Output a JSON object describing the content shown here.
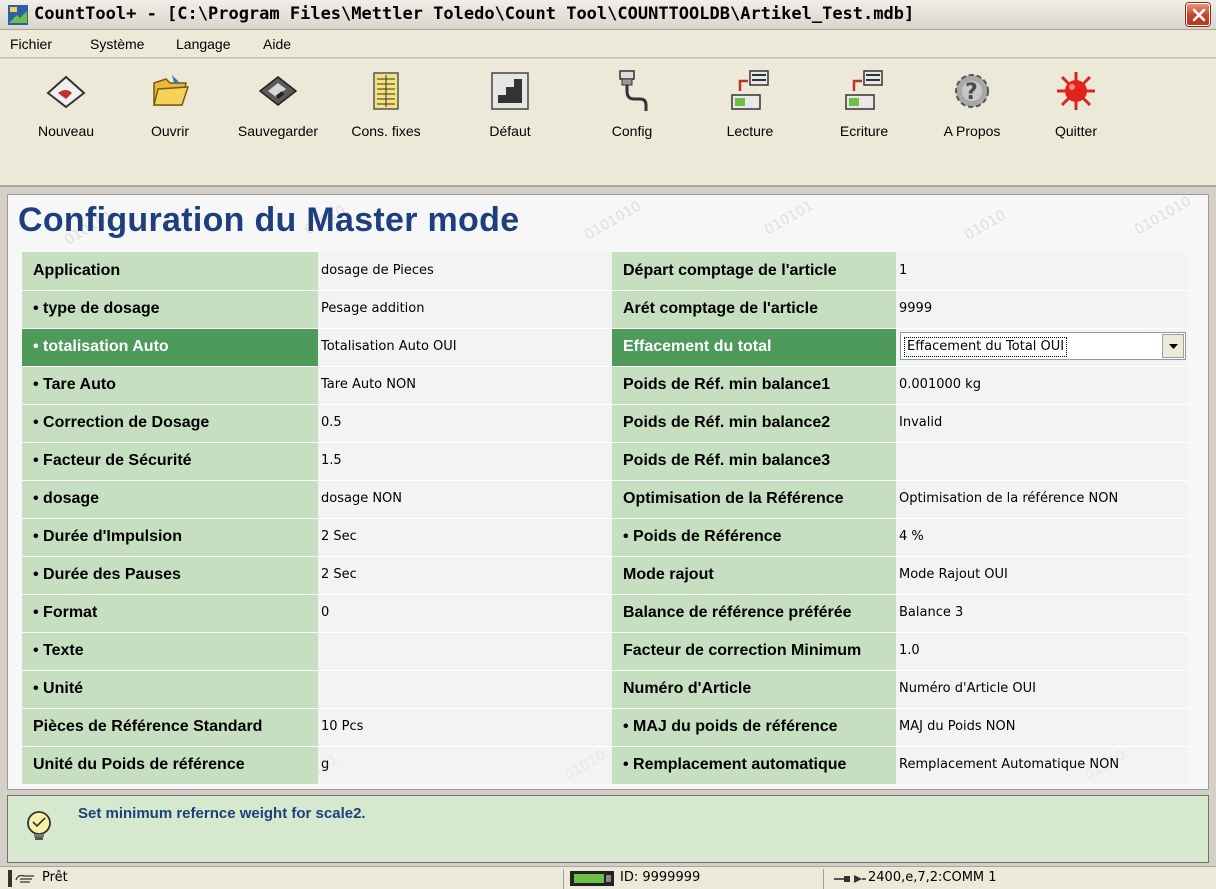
{
  "window": {
    "title": "CountTool+ - [C:\\Program Files\\Mettler Toledo\\Count Tool\\COUNTTOOLDB\\Artikel_Test.mdb]",
    "close_icon": "close-icon"
  },
  "menu": [
    {
      "label": "Fichier"
    },
    {
      "label": "Système"
    },
    {
      "label": "Langage"
    },
    {
      "label": "Aide"
    }
  ],
  "toolbar": [
    {
      "label": "Nouveau",
      "icon": "new-icon"
    },
    {
      "label": "Ouvrir",
      "icon": "open-icon"
    },
    {
      "label": "Sauvegarder",
      "icon": "save-icon"
    },
    {
      "label": "Cons. fixes",
      "icon": "constants-icon"
    },
    {
      "label": "Défaut",
      "icon": "default-icon"
    },
    {
      "label": "Config",
      "icon": "config-icon"
    },
    {
      "label": "Lecture",
      "icon": "read-icon"
    },
    {
      "label": "Ecriture",
      "icon": "write-icon"
    },
    {
      "label": "A Propos",
      "icon": "about-icon"
    },
    {
      "label": "Quitter",
      "icon": "quit-icon"
    }
  ],
  "main": {
    "title": "Configuration du Master mode",
    "rows": [
      {
        "l1": "Application",
        "v1": "dosage de Pieces",
        "l2": "Départ comptage de l'article",
        "v2": "1"
      },
      {
        "l1": "• type de dosage",
        "v1": "Pesage addition",
        "l2": "Arét comptage de l'article",
        "v2": "9999"
      },
      {
        "l1": "• totalisation Auto",
        "v1": "Totalisation Auto OUI",
        "l2": "Effacement du total",
        "v2": "Effacement du Total OUI"
      },
      {
        "l1": "• Tare Auto",
        "v1": "Tare Auto NON",
        "l2": "Poids de Réf. min balance1",
        "v2": "0.001000 kg"
      },
      {
        "l1": "• Correction de Dosage",
        "v1": "0.5",
        "l2": "Poids de Réf. min balance2",
        "v2": "Invalid"
      },
      {
        "l1": "• Facteur de Sécurité",
        "v1": "1.5",
        "l2": "Poids de Réf. min balance3",
        "v2": ""
      },
      {
        "l1": "• dosage",
        "v1": "dosage NON",
        "l2": "Optimisation de la Référence",
        "v2": "Optimisation de la référence NON"
      },
      {
        "l1": "• Durée d'Impulsion",
        "v1": "2 Sec",
        "l2": "• Poids de Référence",
        "v2": "4 %"
      },
      {
        "l1": "• Durée des Pauses",
        "v1": "2 Sec",
        "l2": "Mode rajout",
        "v2": "Mode Rajout OUI"
      },
      {
        "l1": "• Format",
        "v1": "0",
        "l2": "Balance de référence préférée",
        "v2": "Balance 3"
      },
      {
        "l1": "• Texte",
        "v1": "",
        "l2": "Facteur de correction Minimum",
        "v2": "1.0"
      },
      {
        "l1": "• Unité",
        "v1": "",
        "l2": "Numéro d'Article",
        "v2": "Numéro d'Article OUI"
      },
      {
        "l1": "Pièces de Référence Standard",
        "v1": "10 Pcs",
        "l2": "• MAJ du poids de référence",
        "v2": "MAJ du Poids NON"
      },
      {
        "l1": "Unité du Poids de référence",
        "v1": "g",
        "l2": "• Remplacement automatique",
        "v2": "Remplacement Automatique NON"
      }
    ],
    "selected_row": 2,
    "selected_color": "#4d9a5a"
  },
  "help": {
    "text": "Set minimum refernce weight for scale2.",
    "icon": "lightbulb-icon"
  },
  "status": {
    "ready": "Prêt",
    "id": "ID: 9999999",
    "comm": "2400,e,7,2:COMM 1"
  }
}
